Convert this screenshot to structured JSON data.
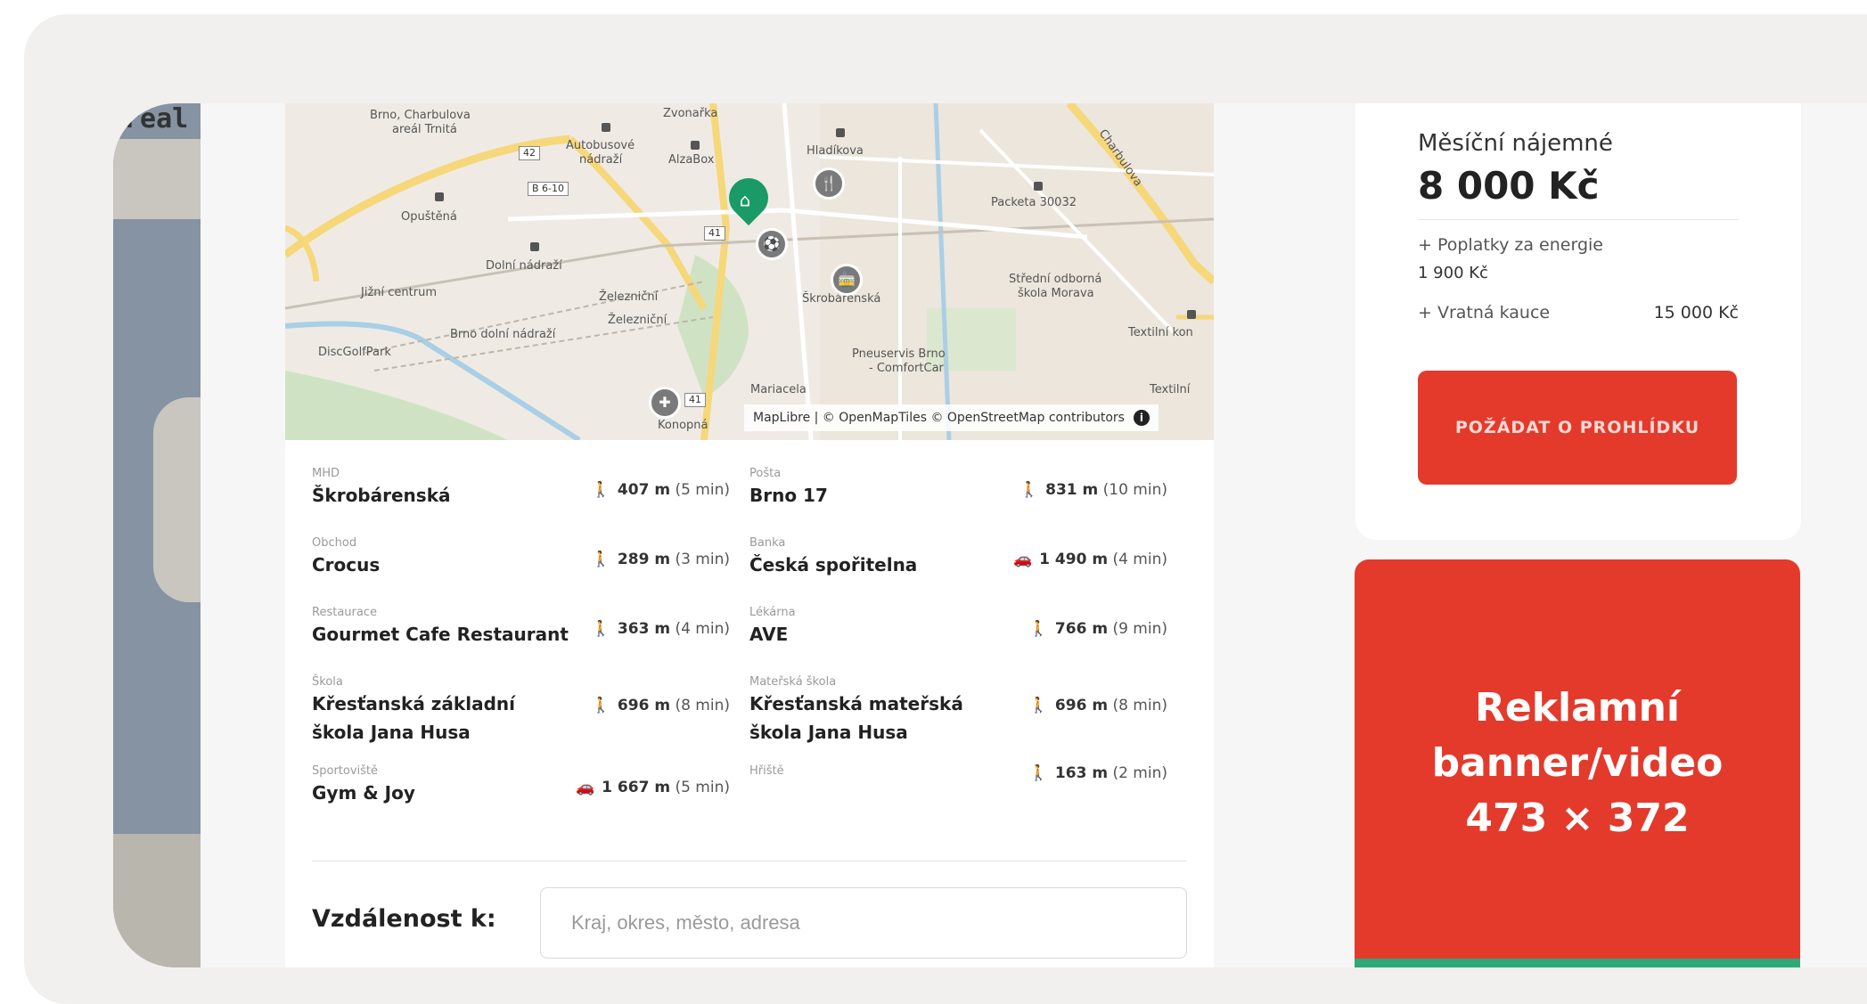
{
  "left_strip": {
    "logo_fragment": "real"
  },
  "map": {
    "labels": [
      {
        "text": "Brno, Charbulova"
      },
      {
        "text": "areál Trnitá"
      },
      {
        "text": "Zvonařka"
      },
      {
        "text": "Autobusové"
      },
      {
        "text": "nádraží"
      },
      {
        "text": "AlzaBox"
      },
      {
        "text": "Hladíkova"
      },
      {
        "text": "Opuštěná"
      },
      {
        "text": "Dolní nádraží"
      },
      {
        "text": "Jižní centrum"
      },
      {
        "text": "Železniční"
      },
      {
        "text": "Železniční"
      },
      {
        "text": "Brno dolní nádraží"
      },
      {
        "text": "DiscGolfPark"
      },
      {
        "text": "Škrobárenská"
      },
      {
        "text": "Packeta 30032"
      },
      {
        "text": "Střední odborná"
      },
      {
        "text": "škola Morava"
      },
      {
        "text": "Textilní kon"
      },
      {
        "text": "Pneuservis Brno"
      },
      {
        "text": "- ComfortCar"
      },
      {
        "text": "Mariacela"
      },
      {
        "text": "Konopná"
      },
      {
        "text": "Charbulova"
      },
      {
        "text": "Textilní"
      }
    ],
    "road_badges": [
      "42",
      "B 6-10",
      "41",
      "41"
    ],
    "attribution": "MapLibre | © OpenMapTiles © OpenStreetMap contributors",
    "info_icon": "i"
  },
  "amenities": [
    {
      "category": "MHD",
      "name": "Škrobárenská",
      "mode": "walk",
      "distance": "407 m",
      "time": "(5 min)"
    },
    {
      "category": "Pošta",
      "name": "Brno 17",
      "mode": "walk",
      "distance": "831 m",
      "time": "(10 min)"
    },
    {
      "category": "Obchod",
      "name": "Crocus",
      "mode": "walk",
      "distance": "289 m",
      "time": "(3 min)"
    },
    {
      "category": "Banka",
      "name": "Česká spořitelna",
      "mode": "car",
      "distance": "1 490 m",
      "time": "(4 min)"
    },
    {
      "category": "Restaurace",
      "name": "Gourmet Cafe Restaurant",
      "mode": "walk",
      "distance": "363 m",
      "time": "(4 min)"
    },
    {
      "category": "Lékárna",
      "name": "AVE",
      "mode": "walk",
      "distance": "766 m",
      "time": "(9 min)"
    },
    {
      "category": "Škola",
      "name": "Křesťanská základní škola Jana Husa",
      "mode": "walk",
      "distance": "696 m",
      "time": "(8 min)"
    },
    {
      "category": "Mateřská škola",
      "name": "Křesťanská mateřská škola Jana Husa",
      "mode": "walk",
      "distance": "696 m",
      "time": "(8 min)"
    },
    {
      "category": "Sportoviště",
      "name": "Gym & Joy",
      "mode": "car",
      "distance": "1 667 m",
      "time": "(5 min)"
    },
    {
      "category": "Hřiště",
      "name": "",
      "mode": "walk",
      "distance": "163 m",
      "time": "(2 min)"
    }
  ],
  "distance_search": {
    "label": "Vzdálenost k:",
    "placeholder": "Kraj, okres, město, adresa"
  },
  "pricing": {
    "rent_label": "Měsíční nájemné",
    "rent_value": "8 000 Kč",
    "energy_label": "+ Poplatky za energie",
    "energy_value": "1 900 Kč",
    "deposit_label": "+ Vratná kauce",
    "deposit_value": "15 000 Kč",
    "cta_label": "POŽÁDAT O PROHLÍDKU"
  },
  "ad": {
    "text": "Reklamní banner/video 473 × 372"
  },
  "colors": {
    "accent_red": "#e33a2c",
    "pin_green": "#1a9a66",
    "walk_icon": "#f0a020",
    "car_icon": "#8a6fa8"
  }
}
